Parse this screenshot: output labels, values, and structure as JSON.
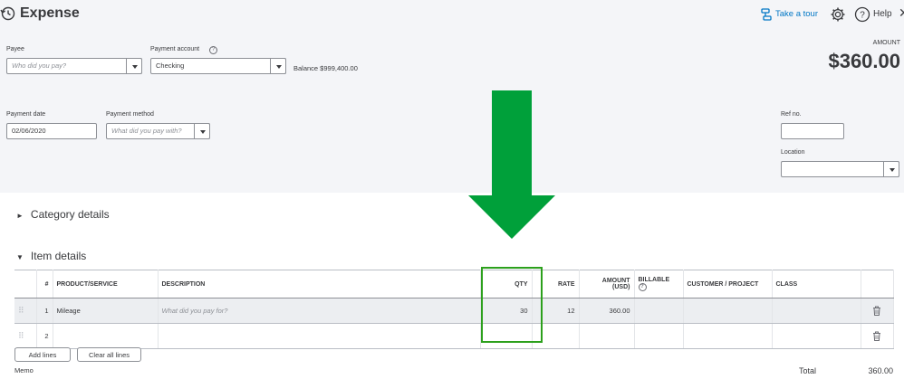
{
  "header": {
    "title": "Expense",
    "take_tour": "Take a tour",
    "help": "Help"
  },
  "payee": {
    "label": "Payee",
    "placeholder": "Who did you pay?"
  },
  "payment_account": {
    "label": "Payment account",
    "value": "Checking",
    "balance": "Balance $999,400.00"
  },
  "amount": {
    "label": "AMOUNT",
    "value": "$360.00"
  },
  "payment_date": {
    "label": "Payment date",
    "value": "02/06/2020"
  },
  "payment_method": {
    "label": "Payment method",
    "placeholder": "What did you pay with?"
  },
  "ref_no": {
    "label": "Ref no.",
    "value": ""
  },
  "location": {
    "label": "Location",
    "value": ""
  },
  "sections": {
    "category": "Category details",
    "item": "Item details"
  },
  "table": {
    "columns": [
      "#",
      "PRODUCT/SERVICE",
      "DESCRIPTION",
      "QTY",
      "RATE",
      "AMOUNT (USD)",
      "BILLABLE",
      "CUSTOMER / PROJECT",
      "CLASS"
    ],
    "rows": [
      {
        "num": "1",
        "product": "Mileage",
        "description_placeholder": "What did you pay for?",
        "qty": "30",
        "rate": "12",
        "amount": "360.00"
      },
      {
        "num": "2",
        "product": "",
        "description_placeholder": "",
        "qty": "",
        "rate": "",
        "amount": ""
      }
    ]
  },
  "buttons": {
    "add_lines": "Add lines",
    "clear_lines": "Clear all lines"
  },
  "footer": {
    "memo": "Memo",
    "total_label": "Total",
    "total_value": "360.00"
  },
  "colors": {
    "highlight": "#2ca01c",
    "link": "#0077c5",
    "header_bg": "#f4f5f8"
  },
  "annotations": {
    "qty_highlight": "green box around QTY column",
    "arrow": "green down arrow"
  }
}
